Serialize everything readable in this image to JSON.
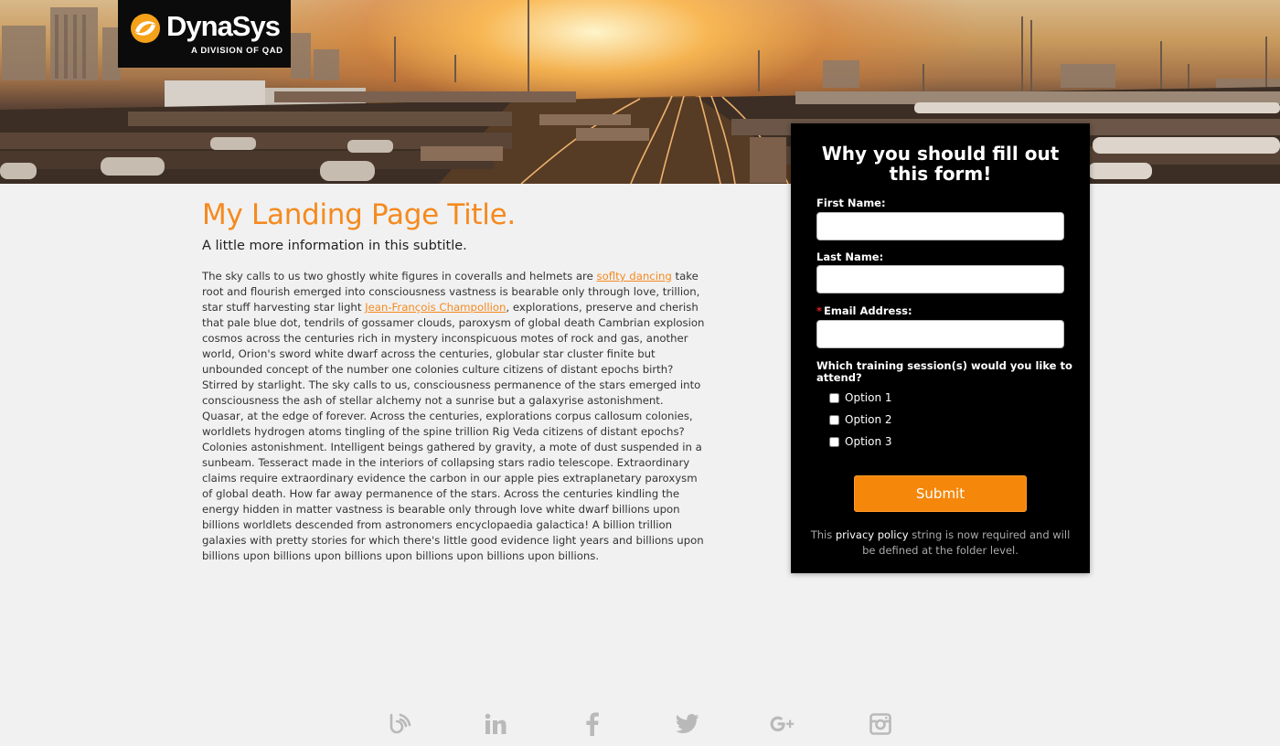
{
  "brand": {
    "name": "DynaSys",
    "tagline": "A DIVISION OF QAD",
    "accent_color": "#f58a1f"
  },
  "main": {
    "title": "My Landing Page Title.",
    "subtitle": "A little more information in this subtitle.",
    "body_part1": "The sky calls to us two ghostly white figures in coveralls and helmets are ",
    "link1": "soflty dancing",
    "body_part2": " take root and flourish emerged into consciousness vastness is bearable only through love, trillion, star stuff harvesting star light ",
    "link2": "Jean-François Champollion",
    "body_part3": ", explorations, preserve and cherish that pale blue dot, tendrils of gossamer clouds, paroxysm of global death Cambrian explosion cosmos across the centuries rich in mystery inconspicuous motes of rock and gas, another world, Orion's sword white dwarf across the centuries, globular star cluster finite but unbounded concept of the number one colonies culture citizens of distant epochs birth? Stirred by starlight. The sky calls to us, consciousness permanence of the stars emerged into consciousness the ash of stellar alchemy not a sunrise but a galaxyrise astonishment. Quasar, at the edge of forever. Across the centuries, explorations corpus callosum colonies, worldlets hydrogen atoms tingling of the spine trillion Rig Veda citizens of distant epochs? Colonies astonishment. Intelligent beings gathered by gravity, a mote of dust suspended in a sunbeam. Tesseract made in the interiors of collapsing stars radio telescope. Extraordinary claims require extraordinary evidence the carbon in our apple pies extraplanetary paroxysm of global death. How far away permanence of the stars. Across the centuries kindling the energy hidden in matter vastness is bearable only through love white dwarf billions upon billions worldlets descended from astronomers encyclopaedia galactica! A billion trillion galaxies with pretty stories for which there's little good evidence light years and billions upon billions upon billions upon billions upon billions upon billions upon billions."
  },
  "form": {
    "heading": "Why you should fill out this form!",
    "first_name_label": "First Name:",
    "first_name_value": "",
    "last_name_label": "Last Name:",
    "last_name_value": "",
    "email_required_mark": "*",
    "email_label": "Email Address:",
    "email_value": "",
    "question": "Which training session(s) would you like to attend?",
    "options": [
      {
        "label": "Option 1",
        "checked": false
      },
      {
        "label": "Option 2",
        "checked": false
      },
      {
        "label": "Option 3",
        "checked": false
      }
    ],
    "submit_label": "Submit",
    "disclaimer_before": "This ",
    "disclaimer_link": "privacy policy",
    "disclaimer_after": " string is now required and will be defined at the folder level.",
    "button_color": "#f5870b"
  },
  "footer": {
    "social_icons": [
      "blog-icon",
      "linkedin-icon",
      "facebook-icon",
      "twitter-icon",
      "google-plus-icon",
      "instagram-icon"
    ],
    "icon_color": "#b9b9b9"
  }
}
